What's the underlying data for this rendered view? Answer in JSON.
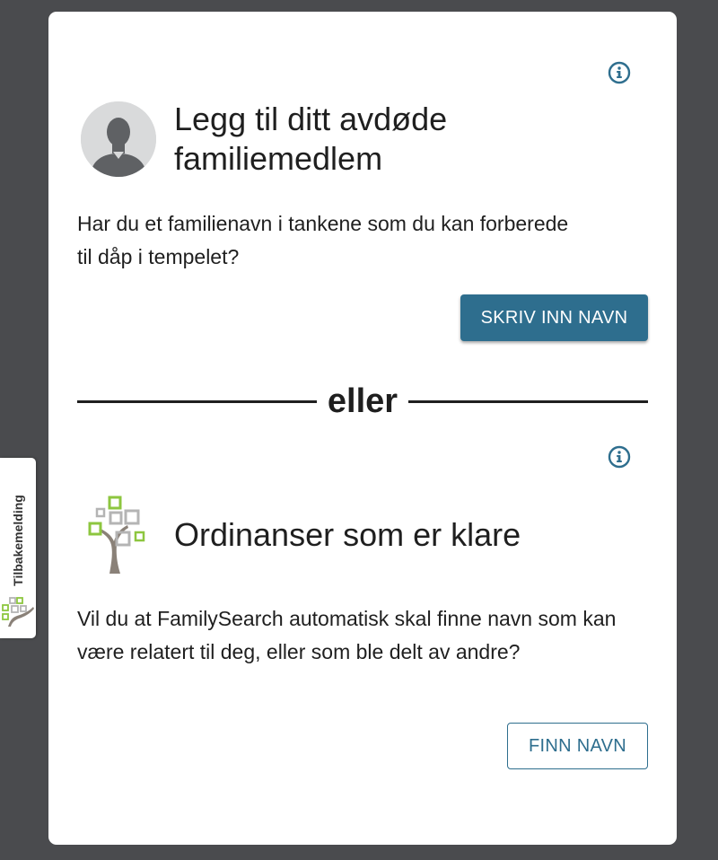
{
  "section_add": {
    "title": "Legg til ditt avdøde familiemedlem",
    "description": "Har du et familienavn i tankene som du kan forberede til dåp i tempelet?",
    "button_label": "SKRIV INN NAVN"
  },
  "divider_text": "eller",
  "section_ready": {
    "title": "Ordinanser som er klare",
    "description": "Vil du at FamilySearch automatisk skal finne navn som kan være relatert til deg, eller som ble delt av andre?",
    "button_label": "FINN NAVN"
  },
  "feedback_tab": {
    "label": "Tilbakemelding"
  },
  "colors": {
    "background": "#4a4b4e",
    "card": "#ffffff",
    "primary": "#2e6e8e",
    "text": "#1f1f1f",
    "tree_green": "#8dc63f",
    "tree_gray": "#b4b4b4"
  },
  "icons": [
    "info-icon",
    "avatar-silhouette-icon",
    "family-tree-icon"
  ]
}
